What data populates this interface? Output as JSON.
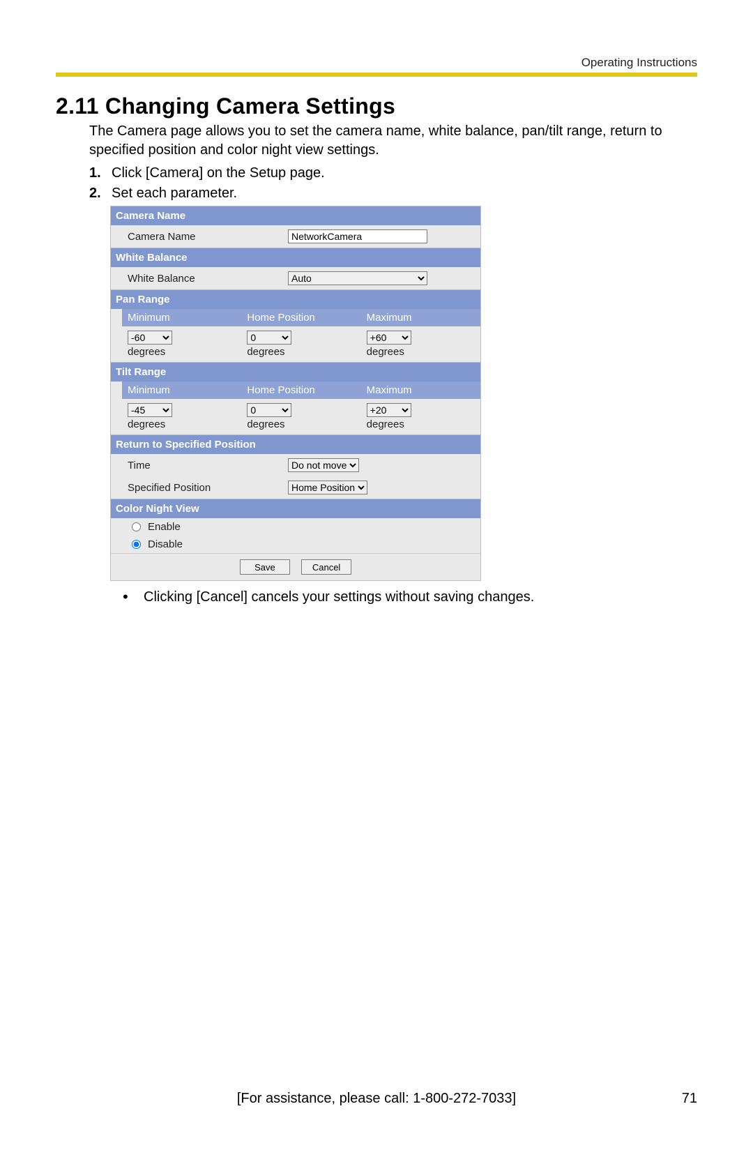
{
  "header": {
    "category": "Operating Instructions"
  },
  "title": "2.11  Changing Camera Settings",
  "intro": "The Camera page allows you to set the camera name, white balance, pan/tilt range, return to specified position and color night view settings.",
  "steps": [
    "Click [Camera] on the Setup page.",
    "Set each parameter."
  ],
  "form": {
    "sections": {
      "camera_name": {
        "header": "Camera Name",
        "label": "Camera Name",
        "value": "NetworkCamera"
      },
      "white_balance": {
        "header": "White Balance",
        "label": "White Balance",
        "value": "Auto"
      },
      "pan_range": {
        "header": "Pan Range",
        "cols": [
          "Minimum",
          "Home Position",
          "Maximum"
        ],
        "values": [
          "-60",
          "0",
          "+60"
        ],
        "unit": "degrees"
      },
      "tilt_range": {
        "header": "Tilt Range",
        "cols": [
          "Minimum",
          "Home Position",
          "Maximum"
        ],
        "values": [
          "-45",
          "0",
          "+20"
        ],
        "unit": "degrees"
      },
      "return_position": {
        "header": "Return to Specified Position",
        "time_label": "Time",
        "time_value": "Do not move",
        "pos_label": "Specified Position",
        "pos_value": "Home Position"
      },
      "color_night_view": {
        "header": "Color Night View",
        "options": [
          "Enable",
          "Disable"
        ],
        "selected": "Disable"
      }
    },
    "buttons": {
      "save": "Save",
      "cancel": "Cancel"
    }
  },
  "note": "Clicking [Cancel] cancels your settings without saving changes.",
  "footer": {
    "assist": "[For assistance, please call: 1-800-272-7033]",
    "page": "71"
  }
}
